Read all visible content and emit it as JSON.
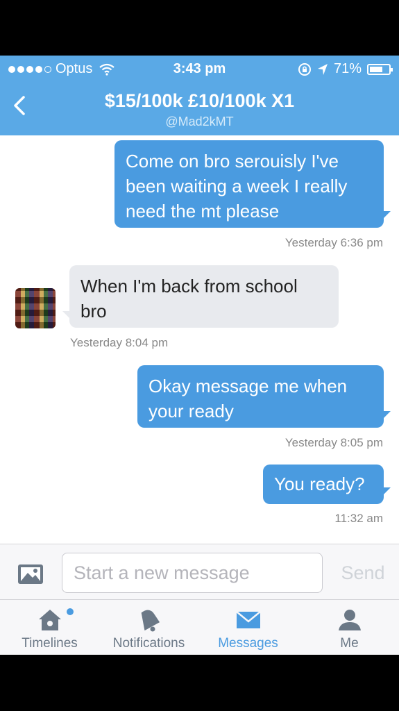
{
  "status_bar": {
    "carrier": "Optus",
    "time": "3:43 pm",
    "battery": "71%",
    "battery_level": 0.71
  },
  "header": {
    "title": "$15/100k £10/100k X1",
    "handle": "@Mad2kMT"
  },
  "messages": [
    {
      "direction": "outgoing",
      "text": "Come on bro serouisly I've been waiting a week I really need the mt please",
      "timestamp": "Yesterday 6:36 pm"
    },
    {
      "direction": "incoming",
      "text": "When I'm back from school bro",
      "timestamp": "Yesterday 8:04 pm"
    },
    {
      "direction": "outgoing",
      "text": "Okay message me when your ready",
      "timestamp": "Yesterday 8:05 pm"
    },
    {
      "direction": "outgoing",
      "text": "You ready?",
      "timestamp": "11:32 am"
    }
  ],
  "composer": {
    "placeholder": "Start a new message",
    "send_label": "Send"
  },
  "tabs": [
    {
      "label": "Timelines",
      "icon": "home-icon",
      "active": false,
      "has_notification": true
    },
    {
      "label": "Notifications",
      "icon": "bell-icon",
      "active": false,
      "has_notification": false
    },
    {
      "label": "Messages",
      "icon": "envelope-icon",
      "active": true,
      "has_notification": false
    },
    {
      "label": "Me",
      "icon": "person-icon",
      "active": false,
      "has_notification": false
    }
  ],
  "colors": {
    "brand_blue": "#5aa9e6",
    "outgoing_bubble": "#4a9be0",
    "incoming_bubble": "#e8eaee"
  }
}
